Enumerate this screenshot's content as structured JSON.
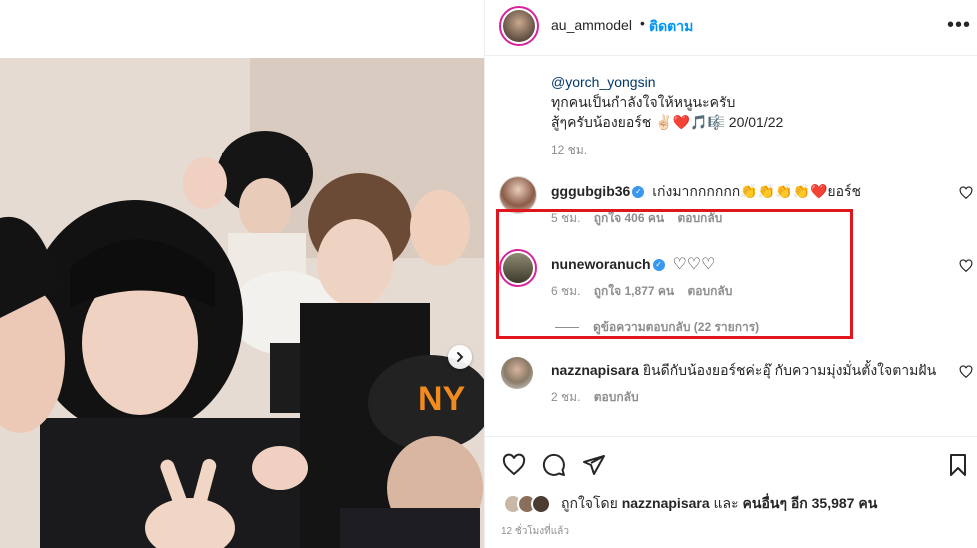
{
  "post": {
    "author": "au_ammodel",
    "dot": "•",
    "follow_label": "ติดตาม",
    "more": "•••",
    "caption": {
      "mention": "@yorch_yongsin",
      "line1": "ทุกคนเป็นกำลังใจให้หนูนะครับ",
      "line2": "สู้ๆครับน้องยอร์ช ✌🏻❤️🎵🎼 20/01/22"
    },
    "caption_time": "12 ชม.",
    "verified_mark": "✓"
  },
  "comments": [
    {
      "username": "gggubgib36",
      "verified": true,
      "text": "เก่งมากกกกกก👏👏👏👏❤️ยอร์ช",
      "time": "5 ชม.",
      "likes": "ถูกใจ 406 คน",
      "reply": "ตอบกลับ"
    },
    {
      "username": "nuneworanuch",
      "verified": true,
      "text": "♡♡♡",
      "time": "6 ชม.",
      "likes": "ถูกใจ 1,877 คน",
      "reply": "ตอบกลับ",
      "view_replies": "ดูข้อความตอบกลับ (22 รายการ)"
    },
    {
      "username": "nazznapisara",
      "verified": false,
      "text": "ยินดีกับน้องยอร์ชค่ะอุ๊ กับความมุ่งมั่นตั้งใจตามฝัน",
      "time": "2 ชม.",
      "reply": "ตอบกลับ"
    }
  ],
  "footer": {
    "liked_prefix": "ถูกใจโดย",
    "liked_user": "nazznapisara",
    "liked_and": "และ",
    "liked_others": "คนอื่นๆ อีก 35,987 คน",
    "post_time": "12 ชั่วโมงที่แล้ว"
  },
  "icons": {
    "like": "heart-icon",
    "comment": "comment-icon",
    "share": "send-icon",
    "save": "bookmark-icon",
    "next": "chevron-right-icon"
  },
  "colors": {
    "link_blue": "#0095f6",
    "verified_blue": "#3897f0",
    "highlight_red": "#e0161e",
    "meta_gray": "#8e8e8e"
  }
}
